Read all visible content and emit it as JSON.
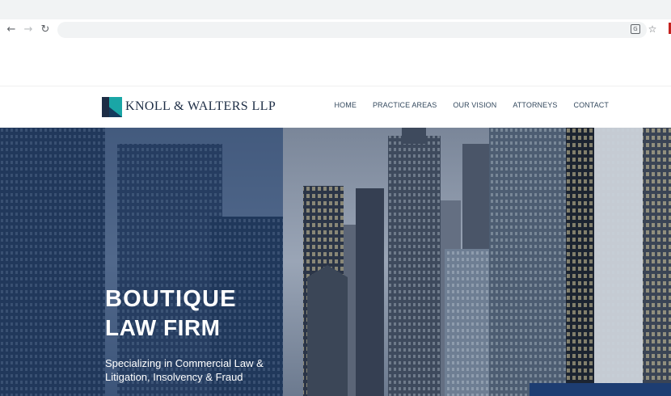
{
  "browser": {
    "back_icon": "arrow-left-icon",
    "forward_icon": "arrow-right-icon",
    "reload_icon": "reload-icon",
    "address_value": "",
    "translate_icon": "translate-icon",
    "bookmark_icon": "star-icon"
  },
  "site": {
    "logo_text": "KNOLL & WALTERS LLP",
    "brand_colors": {
      "navy": "#1d2d45",
      "teal": "#1aa6a6"
    },
    "nav": [
      "HOME",
      "PRACTICE AREAS",
      "OUR VISION",
      "ATTORNEYS",
      "CONTACT"
    ]
  },
  "hero": {
    "title": "BOUTIQUE",
    "subtitle": "LAW FIRM",
    "tagline": "Specializing in Commercial Law & Litigation, Insolvency & Fraud",
    "overlay_color": "#163768",
    "cta_color": "#1d3d72"
  }
}
